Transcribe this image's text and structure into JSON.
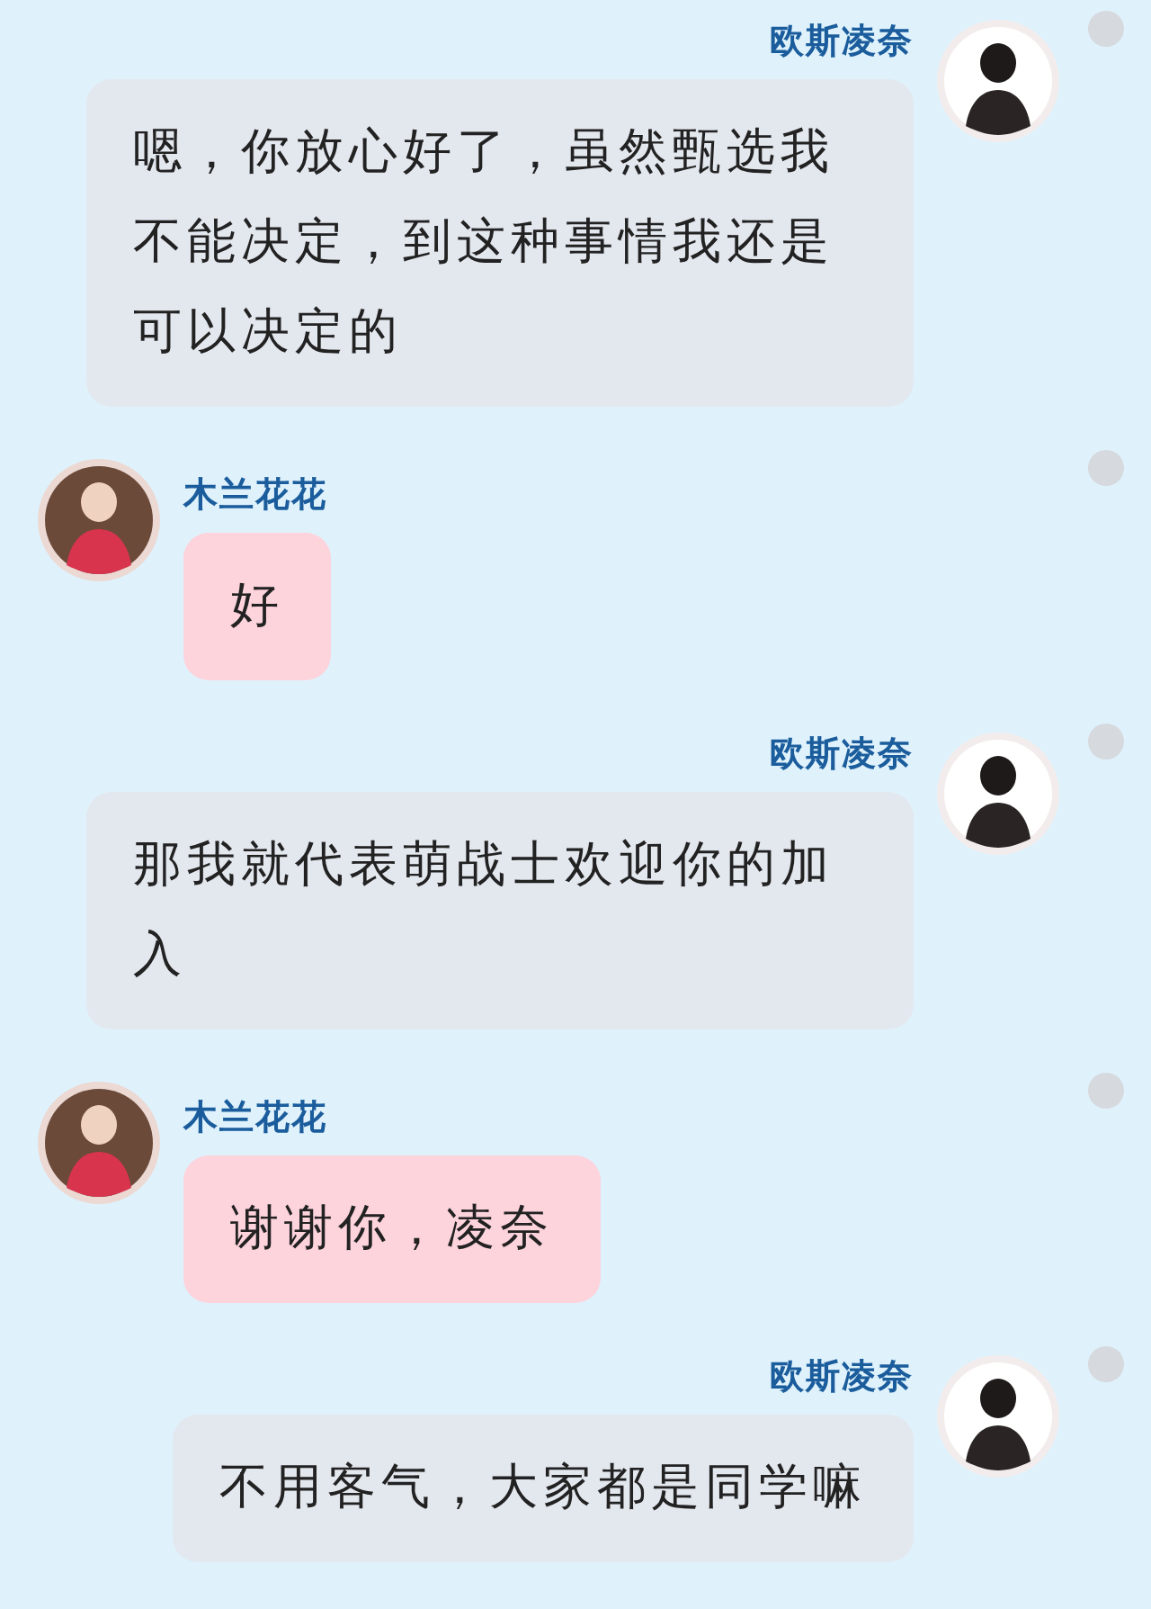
{
  "messages": [
    {
      "kind": "outgoing",
      "sender": "欧斯凌奈",
      "text": "嗯，你放心好了，虽然甄选我不能决定，到这种事情我还是可以决定的"
    },
    {
      "kind": "incoming",
      "sender": "木兰花花",
      "text": "好"
    },
    {
      "kind": "outgoing",
      "sender": "欧斯凌奈",
      "text": "那我就代表萌战士欢迎你的加入"
    },
    {
      "kind": "incoming",
      "sender": "木兰花花",
      "text": "谢谢你，凌奈"
    },
    {
      "kind": "outgoing",
      "sender": "欧斯凌奈",
      "text": "不用客气，大家都是同学嘛"
    }
  ]
}
